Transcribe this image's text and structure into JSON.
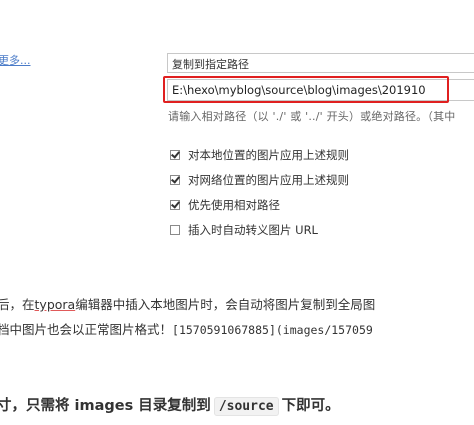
{
  "settings": {
    "more_link": "更多...",
    "select_value": "复制到指定路径",
    "path_value": "E:\\hexo\\myblog\\source\\blog\\images\\201910",
    "hint": "请输入相对路径（以 './' 或 '../' 开头）或绝对路径。（其中",
    "options": [
      {
        "label": "对本地位置的图片应用上述规则",
        "checked": true
      },
      {
        "label": "对网络位置的图片应用上述规则",
        "checked": true
      },
      {
        "label": "优先使用相对路径",
        "checked": true
      },
      {
        "label": "插入时自动转义图片 URL",
        "checked": false
      }
    ]
  },
  "article": {
    "line1_pre": "后，在",
    "line1_link": "typora",
    "line1_post": "编辑器中插入本地图片时，会自动将图片复制到全局图",
    "line2_text": "档中图片也会以正常图片格式！",
    "line2_code": "[1570591067885](images/157059",
    "bold_pre": "寸，只需将 images 目录复制到",
    "bold_code": "/source",
    "bold_post": "下即可。"
  },
  "colors": {
    "highlight": "#e02020",
    "link": "#4a7bc8"
  }
}
